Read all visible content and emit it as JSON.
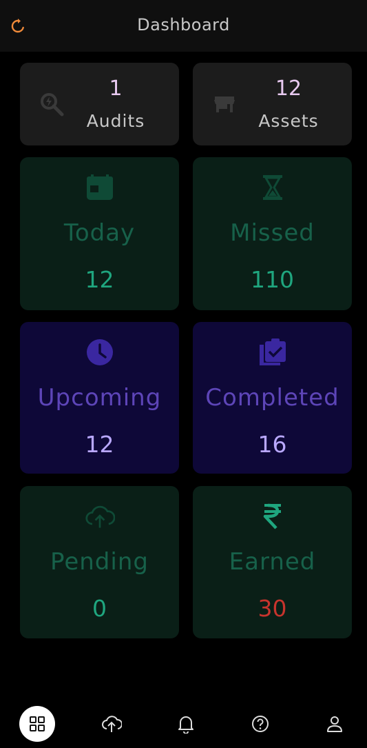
{
  "header": {
    "title": "Dashboard",
    "refresh_icon": "refresh-icon"
  },
  "stats": [
    {
      "number": "1",
      "label": "Audits",
      "icon": "audit-search-icon"
    },
    {
      "number": "12",
      "label": "Assets",
      "icon": "store-icon"
    }
  ],
  "tiles": [
    {
      "label": "Today",
      "value": "12",
      "icon": "calendar-icon"
    },
    {
      "label": "Missed",
      "value": "110",
      "icon": "hourglass-icon"
    },
    {
      "label": "Upcoming",
      "value": "12",
      "icon": "clock-icon"
    },
    {
      "label": "Completed",
      "value": "16",
      "icon": "clipboard-check-icon"
    },
    {
      "label": "Pending",
      "value": "0",
      "icon": "cloud-upload-icon"
    },
    {
      "label": "Earned",
      "value": "30",
      "icon": "rupee-icon"
    }
  ],
  "nav": [
    "dashboard-grid-icon",
    "upload-icon",
    "bell-icon",
    "help-icon",
    "user-icon"
  ],
  "colors": {
    "refresh": "#f08a3a",
    "green_tile": "#0a1f17",
    "purple_tile": "#0e0838",
    "earned_value": "#c7342d"
  }
}
